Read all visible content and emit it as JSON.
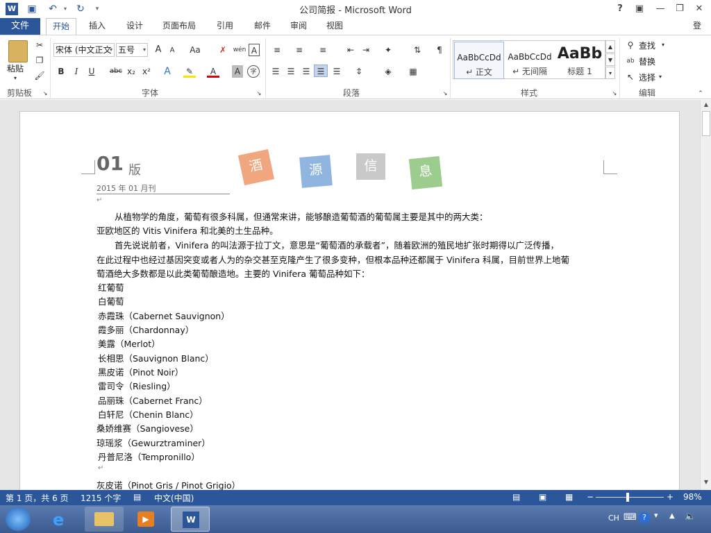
{
  "window": {
    "title": "公司简报 - Microsoft Word",
    "help": "?",
    "login": "登录"
  },
  "tabs": {
    "file": "文件",
    "items": [
      "开始",
      "插入",
      "设计",
      "页面布局",
      "引用",
      "邮件",
      "审阅",
      "视图"
    ]
  },
  "ribbon": {
    "clipboard": {
      "paste": "粘贴",
      "label": "剪贴板"
    },
    "font": {
      "name": "宋体 (中文正文",
      "size": "五号",
      "label": "字体",
      "grow": "A",
      "shrink": "A",
      "case": "Aa",
      "bold": "B",
      "italic": "I",
      "underline": "U",
      "strike": "abc",
      "sub": "x₂",
      "sup": "x²",
      "phonetic": "wén",
      "border_char": "A",
      "char_shade": "A",
      "circle": "字"
    },
    "paragraph": {
      "label": "段落"
    },
    "styles": {
      "label": "样式",
      "items": [
        {
          "preview": "AaBbCcDd",
          "name": "↵ 正文"
        },
        {
          "preview": "AaBbCcDd",
          "name": "↵ 无间隔"
        },
        {
          "preview": "AaBb",
          "name": "标题 1"
        }
      ]
    },
    "editing": {
      "label": "编辑",
      "find": "查找",
      "replace": "替换",
      "select": "选择"
    }
  },
  "document": {
    "header": {
      "issue": "01",
      "issue_unit": "版",
      "date": "2015 年 01 月刊",
      "cards": [
        {
          "char": "酒",
          "color": "#f0a67e"
        },
        {
          "char": "源",
          "color": "#8fb5e0"
        },
        {
          "char": "信",
          "color": "#c9c9c9"
        },
        {
          "char": "息",
          "color": "#9ccd8f"
        }
      ]
    },
    "paragraphs": [
      "从植物学的角度，葡萄有很多科属，但通常来讲，能够酿造葡萄酒的葡萄属主要是其中的两大类：",
      "亚欧地区的 Vitis Vinifera 和北美的土生品种。",
      "首先说说前者，Vinifera 的叫法源于拉丁文，意思是“葡萄酒的承载者”，随着欧洲的殖民地扩张时期得以广泛传播，",
      "在此过程中也经过基因突变或者人为的杂交甚至克隆产生了很多变种，但根本品种还都属于 Vinifera 科属，目前世界上地葡",
      "萄酒绝大多数都是以此类葡萄酿造地。主要的 Vinifera 葡萄品种如下："
    ],
    "varieties": [
      "红葡萄",
      "白葡萄",
      "赤霞珠（Cabernet Sauvignon）",
      "霞多丽（Chardonnay）",
      "美露（Merlot）",
      "长相思（Sauvignon Blanc）",
      " 黑皮诺（Pinot Noir）",
      "雷司令（Riesling）",
      "品丽珠（Cabernet Franc）",
      "白轩尼（Chenin Blanc） ",
      "桑娇维赛（Sangiovese） ",
      "琼瑶浆（Gewurztraminer）",
      "丹普尼洛（Tempronillo）",
      "",
      "灰皮诺（Pinot Gris / Pinot Grigio）"
    ]
  },
  "status": {
    "page": "第 1 页，共 6 页",
    "words": "1215 个字",
    "language": "中文(中国)",
    "zoom": "98%"
  },
  "taskbar": {
    "lang": "CH"
  }
}
